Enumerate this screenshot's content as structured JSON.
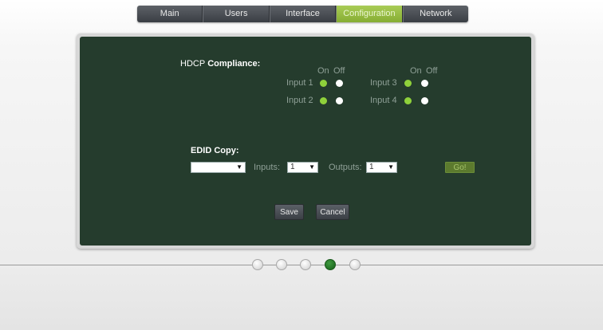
{
  "nav": {
    "tabs": [
      {
        "label": "Main"
      },
      {
        "label": "Users"
      },
      {
        "label": "Interface"
      },
      {
        "label": "Configuration",
        "active": true
      },
      {
        "label": "Network"
      }
    ]
  },
  "hdcp": {
    "title_part1": "HDCP",
    "title_part2": "Compliance:",
    "on_label": "On",
    "off_label": "Off",
    "inputs": [
      {
        "label": "Input 1",
        "on_selected": true
      },
      {
        "label": "Input 2",
        "on_selected": true
      },
      {
        "label": "Input 3",
        "on_selected": true
      },
      {
        "label": "Input 4",
        "on_selected": true
      }
    ]
  },
  "edid": {
    "title": "EDID Copy:",
    "source_value": "",
    "inputs_label": "Inputs:",
    "inputs_value": "1",
    "outputs_label": "Outputs:",
    "outputs_value": "1",
    "go_label": "Go!"
  },
  "actions": {
    "save_label": "Save",
    "cancel_label": "Cancel"
  },
  "pager": {
    "page_count": 5,
    "current_page": 4
  },
  "colors": {
    "panel_bg": "#253c2d",
    "accent_green": "#8fd13b",
    "active_tab": "#a9cc56"
  }
}
